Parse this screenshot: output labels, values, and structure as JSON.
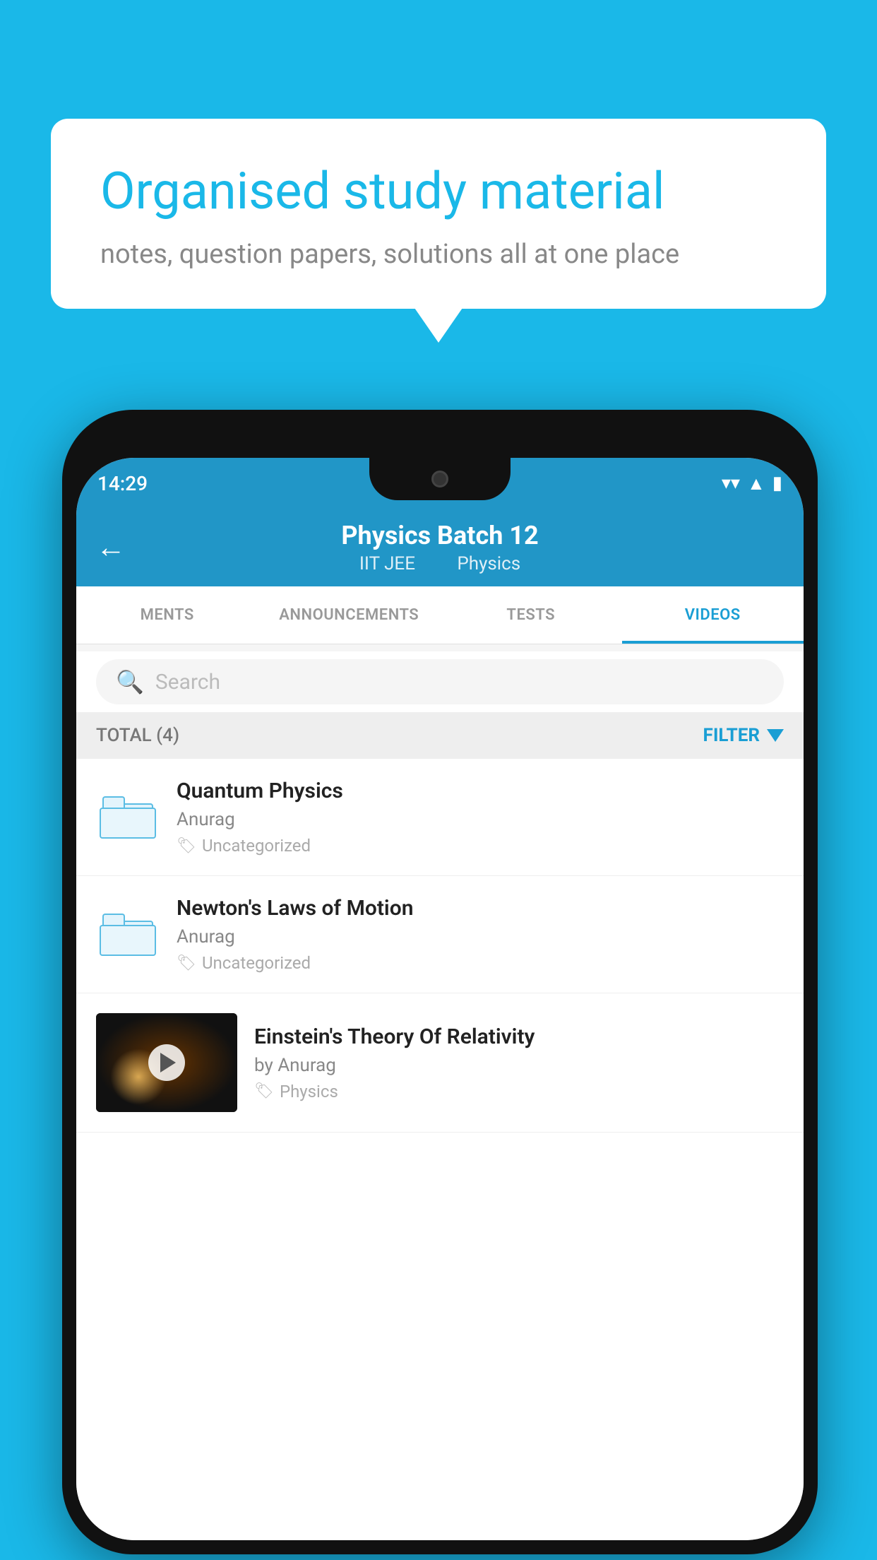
{
  "background": {
    "color": "#1ab8e8"
  },
  "bubble": {
    "title": "Organised study material",
    "subtitle": "notes, question papers, solutions all at one place"
  },
  "status_bar": {
    "time": "14:29",
    "wifi": "▾",
    "signal": "▲",
    "battery": "▮"
  },
  "header": {
    "back_label": "←",
    "title": "Physics Batch 12",
    "subtitle_1": "IIT JEE",
    "subtitle_2": "Physics"
  },
  "tabs": [
    {
      "label": "MENTS",
      "active": false
    },
    {
      "label": "ANNOUNCEMENTS",
      "active": false
    },
    {
      "label": "TESTS",
      "active": false
    },
    {
      "label": "VIDEOS",
      "active": true
    }
  ],
  "search": {
    "placeholder": "Search"
  },
  "filter": {
    "total_label": "TOTAL (4)",
    "filter_label": "FILTER"
  },
  "list_items": [
    {
      "id": 1,
      "title": "Quantum Physics",
      "author": "Anurag",
      "tag": "Uncategorized",
      "type": "folder",
      "has_thumb": false
    },
    {
      "id": 2,
      "title": "Newton's Laws of Motion",
      "author": "Anurag",
      "tag": "Uncategorized",
      "type": "folder",
      "has_thumb": false
    },
    {
      "id": 3,
      "title": "Einstein's Theory Of Relativity",
      "author": "by Anurag",
      "tag": "Physics",
      "type": "video",
      "has_thumb": true
    }
  ]
}
